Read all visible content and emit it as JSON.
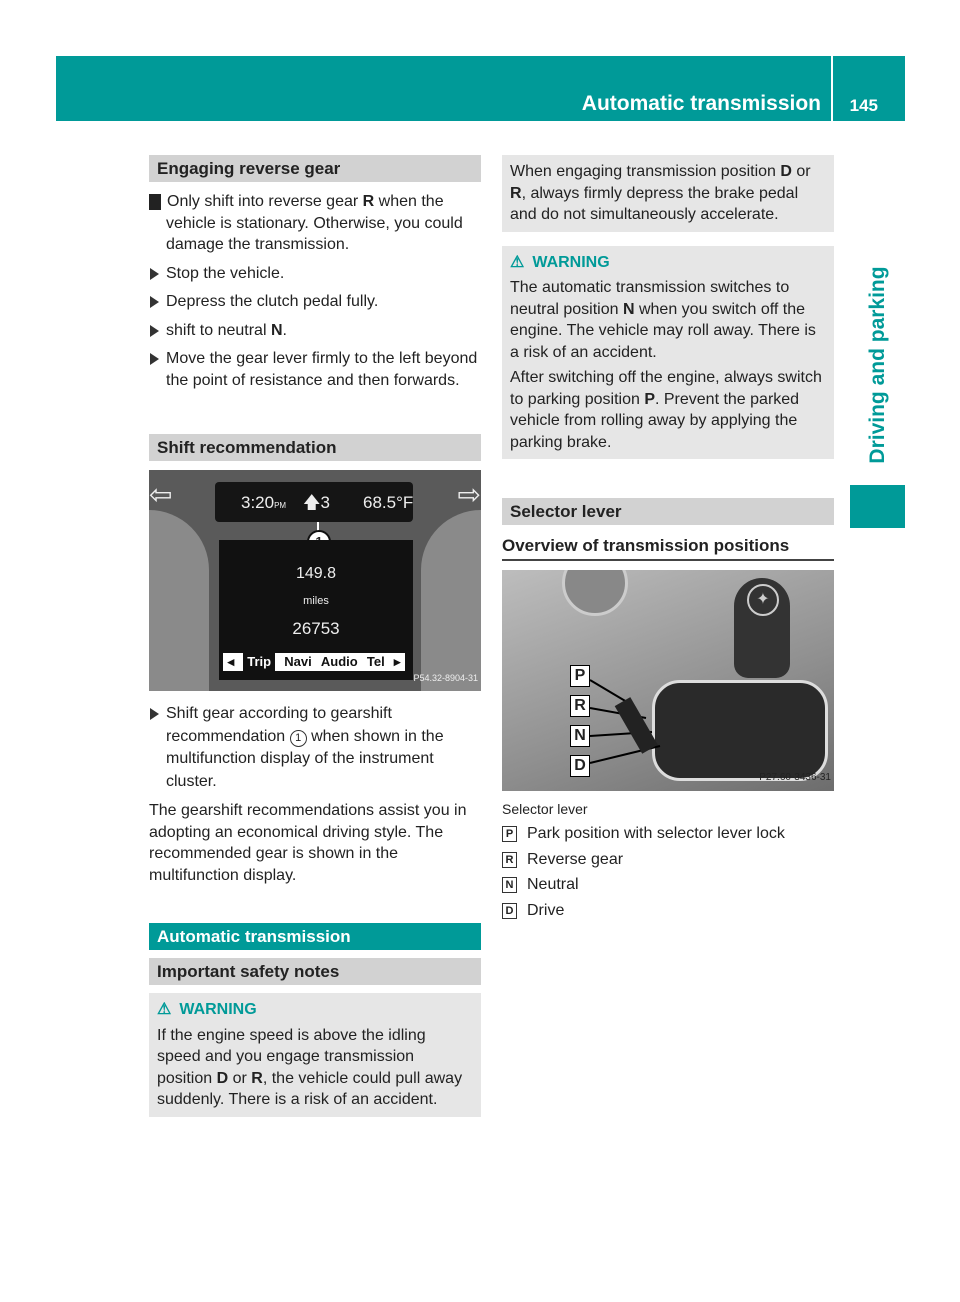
{
  "header": {
    "title": "Automatic transmission",
    "page_number": "145",
    "color": "#009a98"
  },
  "side_tab": {
    "label": "Driving and parking"
  },
  "left": {
    "reverse": {
      "title": "Engaging reverse gear",
      "note_icon": "!",
      "note": [
        "Only shift into reverse gear ",
        "R",
        " when the vehicle is stationary. Otherwise, you could damage the transmission."
      ],
      "steps": [
        "Stop the vehicle.",
        "Depress the clutch pedal fully.",
        "shift to neutral ",
        "Move the gear lever firmly to the left beyond the point of resistance and then forwards."
      ],
      "step3_bold": "N",
      "step3_end": "."
    },
    "shift": {
      "title": "Shift recommendation",
      "figure": {
        "time": "3:20",
        "ampm": "PM",
        "gear": "3",
        "temp": "68.5°F",
        "callout": "1",
        "trip": "149.8",
        "unit": "miles",
        "odo": "26753",
        "menu": [
          "Trip",
          "Navi",
          "Audio",
          "Tel"
        ],
        "code": "P54.32-8904-31"
      },
      "step": [
        "Shift gear according to gearshift recommendation ",
        "1",
        " when shown in the multifunction display of the instrument cluster."
      ],
      "para": "The gearshift recommendations assist you in adopting an economical driving style. The recommended gear is shown in the multifunction display."
    },
    "auto_title": "Automatic transmission",
    "safety": {
      "title": "Important safety notes",
      "warning_label": "WARNING",
      "text": [
        "If the engine speed is above the idling speed and you engage transmission position ",
        "D",
        " or ",
        "R",
        ", the vehicle could pull away suddenly. There is a risk of an accident."
      ]
    }
  },
  "right": {
    "note": [
      "When engaging transmission position ",
      "D",
      " or ",
      "R",
      ", always firmly depress the brake pedal and do not simultaneously accelerate."
    ],
    "warning": {
      "label": "WARNING",
      "p1": [
        "The automatic transmission switches to neutral position ",
        "N",
        " when you switch off the engine. The vehicle may roll away. There is a risk of an accident."
      ],
      "p2": [
        "After switching off the engine, always switch to parking position ",
        "P",
        ". Prevent the parked vehicle from rolling away by applying the parking brake."
      ]
    },
    "selector": {
      "title": "Selector lever",
      "subtitle": "Overview of transmission positions",
      "figure": {
        "labels": [
          "P",
          "R",
          "N",
          "D"
        ],
        "code": "P27.60-3436-31"
      },
      "caption": "Selector lever",
      "legend": [
        {
          "key": "P",
          "text": "Park position with selector lever lock"
        },
        {
          "key": "R",
          "text": "Reverse gear"
        },
        {
          "key": "N",
          "text": "Neutral"
        },
        {
          "key": "D",
          "text": "Drive"
        }
      ]
    }
  }
}
